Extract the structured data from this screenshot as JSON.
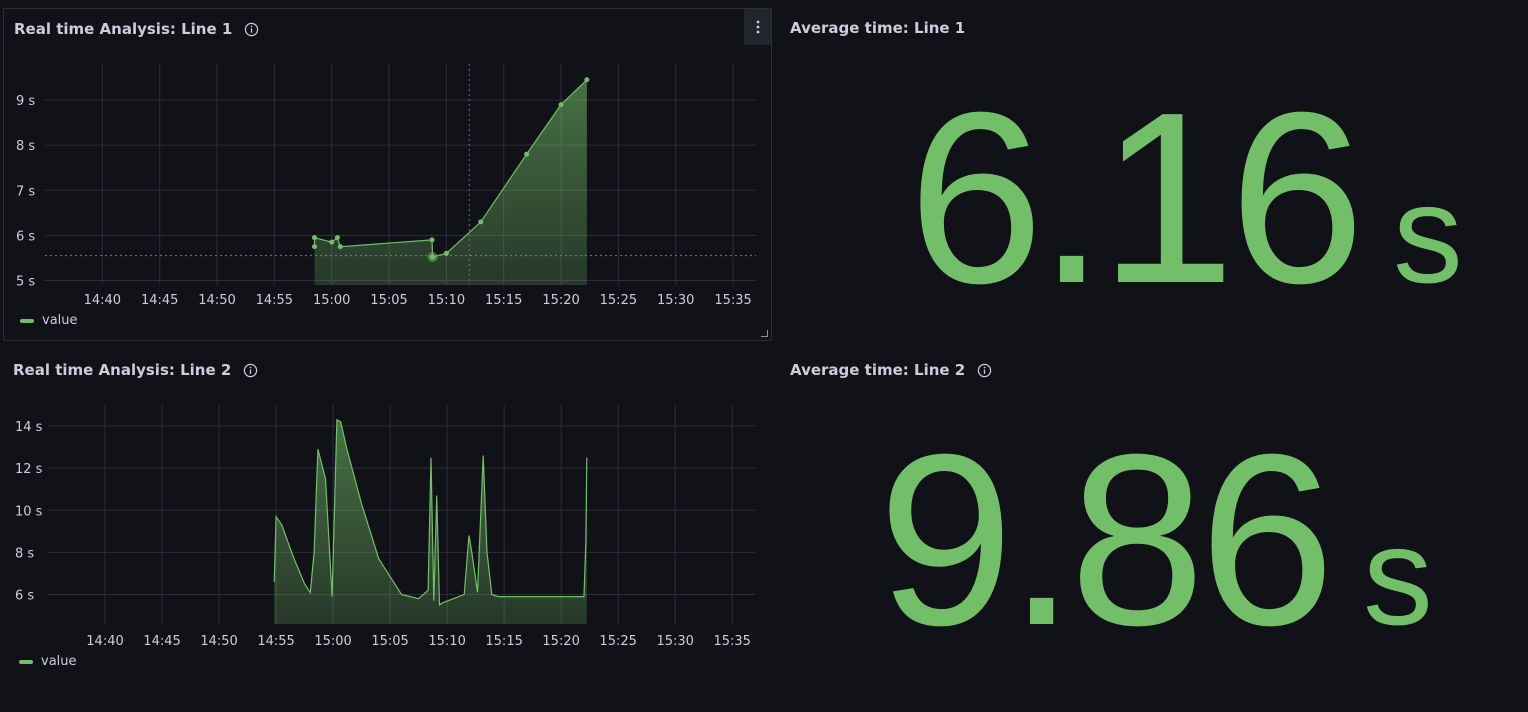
{
  "colors": {
    "background": "#111217",
    "series": "#73bf69",
    "grid": "#2c2f36",
    "text": "#ccccdc"
  },
  "panels": {
    "line1_chart": {
      "title": "Real time Analysis: Line 1",
      "legend": "value"
    },
    "line1_avg": {
      "title": "Average time: Line 1",
      "value": "6.16",
      "unit": "s"
    },
    "line2_chart": {
      "title": "Real time Analysis: Line 2",
      "legend": "value"
    },
    "line2_avg": {
      "title": "Average time: Line 2",
      "value": "9.86",
      "unit": "s"
    }
  },
  "chart_data": [
    {
      "type": "area",
      "title": "Real time Analysis: Line 1",
      "x_ticks": [
        "14:40",
        "14:45",
        "14:50",
        "14:55",
        "15:00",
        "15:05",
        "15:10",
        "15:15",
        "15:20",
        "15:25",
        "15:30",
        "15:35"
      ],
      "y_ticks": [
        "5 s",
        "6 s",
        "7 s",
        "8 s",
        "9 s"
      ],
      "xlim": [
        "14:35",
        "15:37"
      ],
      "ylim": [
        4.9,
        9.8
      ],
      "threshold": 5.55,
      "series": [
        {
          "name": "value",
          "x": [
            "14:58:30",
            "14:58:30",
            "15:00:00",
            "15:00:30",
            "15:00:45",
            "15:08:45",
            "15:08:48",
            "15:10:00",
            "15:13:00",
            "15:17:00",
            "15:20:00",
            "15:22:15"
          ],
          "y": [
            5.75,
            5.95,
            5.85,
            5.95,
            5.75,
            5.9,
            5.52,
            5.6,
            6.3,
            7.8,
            8.9,
            9.45
          ]
        }
      ],
      "legend": "bottom-left",
      "grid": true
    },
    {
      "type": "area",
      "title": "Real time Analysis: Line 2",
      "x_ticks": [
        "14:40",
        "14:45",
        "14:50",
        "14:55",
        "15:00",
        "15:05",
        "15:10",
        "15:15",
        "15:20",
        "15:25",
        "15:30",
        "15:35"
      ],
      "y_ticks": [
        "6 s",
        "8 s",
        "10 s",
        "12 s",
        "14 s"
      ],
      "xlim": [
        "14:35",
        "15:37"
      ],
      "ylim": [
        4.6,
        15.0
      ],
      "series": [
        {
          "name": "value",
          "x": [
            "14:54:50",
            "14:55:00",
            "14:55:30",
            "14:56:30",
            "14:57:30",
            "14:58:00",
            "14:58:20",
            "14:58:40",
            "14:59:20",
            "14:59:55",
            "15:00:20",
            "15:00:40",
            "15:01:10",
            "15:02:30",
            "15:04:00",
            "15:06:00",
            "15:07:30",
            "15:08:20",
            "15:08:35",
            "15:08:50",
            "15:09:05",
            "15:09:20",
            "15:09:35",
            "15:11:30",
            "15:11:55",
            "15:12:10",
            "15:12:40",
            "15:13:10",
            "15:13:30",
            "15:13:55",
            "15:14:30",
            "15:22:00",
            "15:22:10",
            "15:22:15"
          ],
          "y": [
            6.6,
            9.7,
            9.3,
            7.8,
            6.5,
            6.1,
            8.0,
            12.9,
            11.5,
            5.9,
            14.3,
            14.2,
            13.0,
            10.3,
            7.7,
            6.0,
            5.8,
            6.2,
            12.5,
            5.7,
            10.7,
            5.5,
            5.6,
            6.0,
            8.8,
            8.0,
            6.1,
            12.6,
            8.0,
            6.0,
            5.9,
            5.9,
            8.6,
            12.5
          ]
        }
      ],
      "legend": "bottom-left",
      "grid": true
    }
  ]
}
